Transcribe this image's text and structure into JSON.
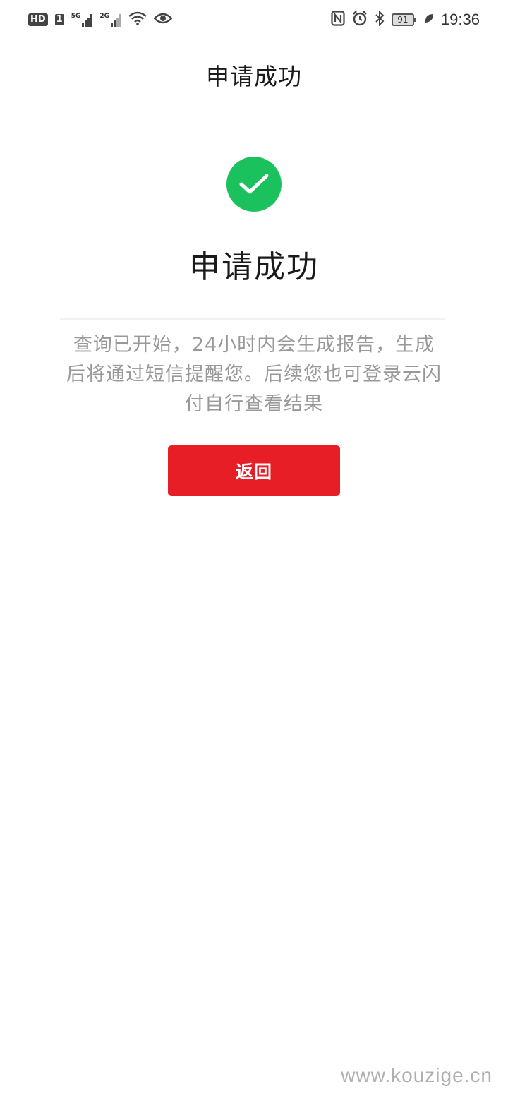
{
  "status_bar": {
    "hd": "HD",
    "sim": "1",
    "net1": "5G",
    "net2": "2G",
    "battery": "91",
    "time": "19:36",
    "icons": [
      "wifi-icon",
      "eye-icon",
      "nfc-icon",
      "alarm-icon",
      "bluetooth-icon",
      "battery-icon",
      "leaf-icon"
    ]
  },
  "header": {
    "title": "申请成功"
  },
  "result": {
    "icon": "check-circle-icon",
    "icon_color": "#1bc15d",
    "title": "申请成功",
    "description": "查询已开始，24小时内会生成报告，生成后将通过短信提醒您。后续您也可登录云闪付自行查看结果"
  },
  "actions": {
    "back_label": "返回",
    "back_color": "#e81e26"
  },
  "watermark": "www.kouzige.cn"
}
